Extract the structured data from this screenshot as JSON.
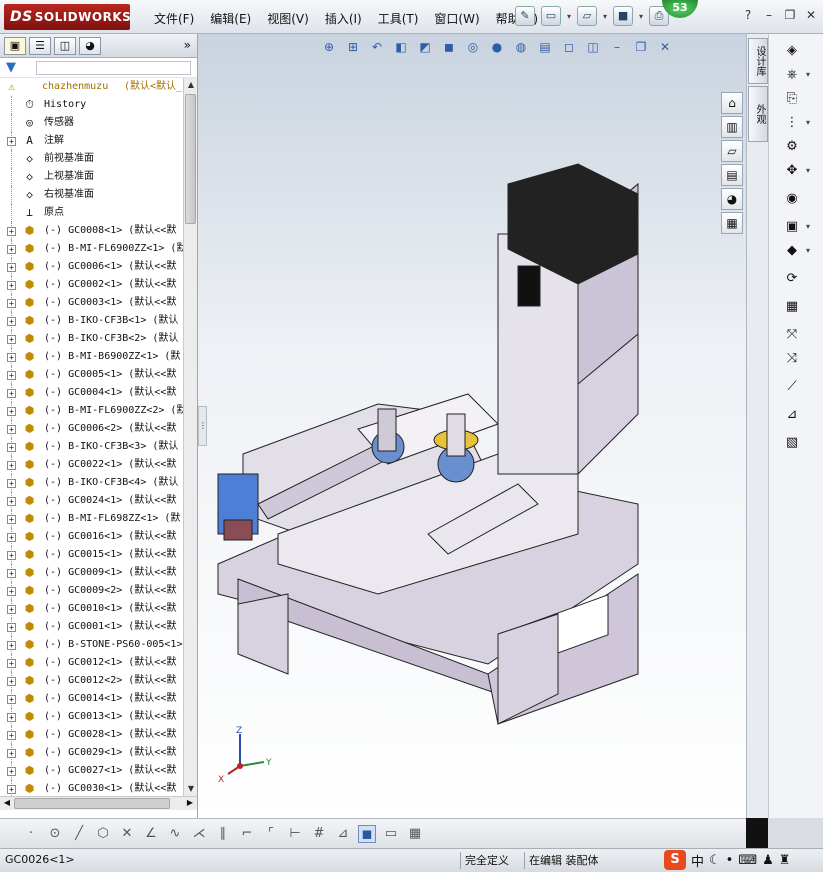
{
  "app": {
    "brand": "SOLIDWORKS",
    "brand_prefix": "DS",
    "notification_count": "53"
  },
  "menu": [
    "文件(F)",
    "编辑(E)",
    "视图(V)",
    "插入(I)",
    "工具(T)",
    "窗口(W)",
    "帮助(H)"
  ],
  "feature_tree": {
    "root": {
      "name": "chazhenmuzu",
      "config": "(默认<默认_"
    },
    "fixed_items": [
      {
        "label": "History",
        "icon": "history-icon"
      },
      {
        "label": "传感器",
        "icon": "sensor-icon"
      },
      {
        "label": "注解",
        "icon": "annotation-icon"
      },
      {
        "label": "前视基准面",
        "icon": "plane-icon"
      },
      {
        "label": "上视基准面",
        "icon": "plane-icon"
      },
      {
        "label": "右视基准面",
        "icon": "plane-icon"
      },
      {
        "label": "原点",
        "icon": "origin-icon"
      }
    ],
    "components": [
      "(-) GC0008<1> (默认<<默",
      "(-) B-MI-FL6900ZZ<1> (默",
      "(-) GC0006<1> (默认<<默",
      "(-) GC0002<1> (默认<<默",
      "(-) GC0003<1> (默认<<默",
      "(-) B-IKO-CF3B<1> (默认",
      "(-) B-IKO-CF3B<2> (默认",
      "(-) B-MI-B6900ZZ<1> (默",
      "(-) GC0005<1> (默认<<默",
      "(-) GC0004<1> (默认<<默",
      "(-) B-MI-FL6900ZZ<2> (默",
      "(-) GC0006<2> (默认<<默",
      "(-) B-IKO-CF3B<3> (默认",
      "(-) GC0022<1> (默认<<默",
      "(-) B-IKO-CF3B<4> (默认",
      "(-) GC0024<1> (默认<<默",
      "(-) B-MI-FL698ZZ<1> (默",
      "(-) GC0016<1> (默认<<默",
      "(-) GC0015<1> (默认<<默",
      "(-) GC0009<1> (默认<<默",
      "(-) GC0009<2> (默认<<默",
      "(-) GC0010<1> (默认<<默",
      "(-) GC0001<1> (默认<<默",
      "(-) B-STONE-PS60-005<1>",
      "(-) GC0012<1> (默认<<默",
      "(-) GC0012<2> (默认<<默",
      "(-) GC0014<1> (默认<<默",
      "(-) GC0013<1> (默认<<默",
      "(-) GC0028<1> (默认<<默",
      "(-) GC0029<1> (默认<<默",
      "(-) GC0027<1> (默认<<默",
      "(-) GC0030<1> (默认<<默"
    ]
  },
  "right_tabs": [
    "设计库",
    "外观"
  ],
  "status": {
    "left": "GC0026<1>",
    "state1": "完全定义",
    "state2": "在编辑 装配体"
  },
  "ime": {
    "logo": "S",
    "lang": "中"
  },
  "triad": {
    "x": "X",
    "y": "Y",
    "z": "Z"
  },
  "colors": {
    "accent": "#b8261f",
    "part": "#c28a00",
    "model": "#dcd6e3"
  }
}
